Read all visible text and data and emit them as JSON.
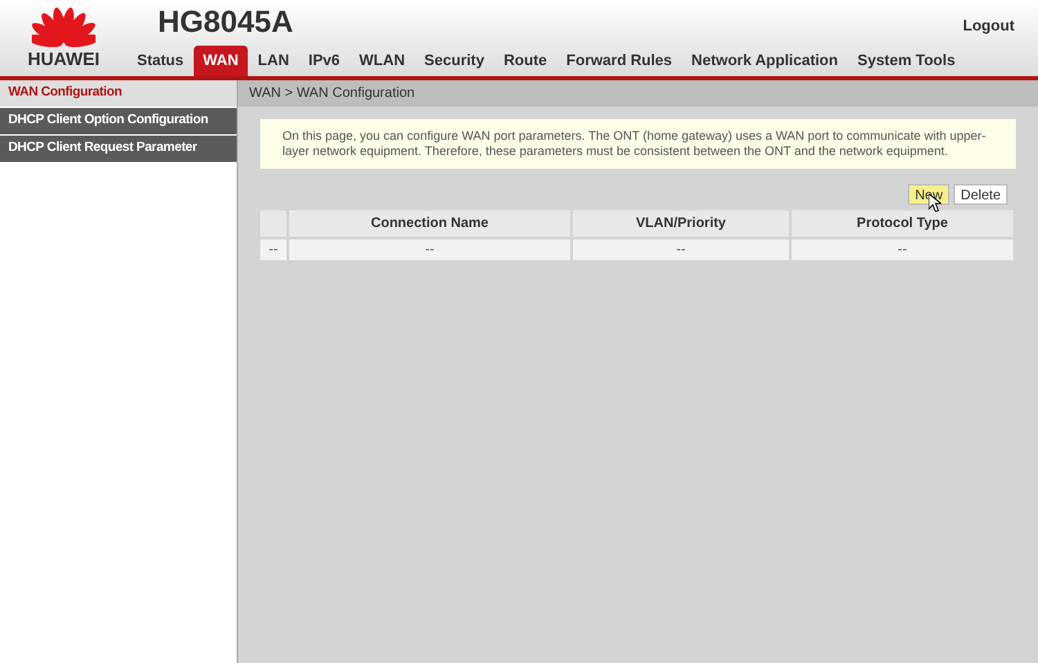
{
  "header": {
    "brand": "HUAWEI",
    "model": "HG8045A",
    "logout": "Logout"
  },
  "nav": [
    {
      "label": "Status",
      "selected": false
    },
    {
      "label": "WAN",
      "selected": true
    },
    {
      "label": "LAN",
      "selected": false
    },
    {
      "label": "IPv6",
      "selected": false
    },
    {
      "label": "WLAN",
      "selected": false
    },
    {
      "label": "Security",
      "selected": false
    },
    {
      "label": "Route",
      "selected": false
    },
    {
      "label": "Forward Rules",
      "selected": false
    },
    {
      "label": "Network Application",
      "selected": false
    },
    {
      "label": "System Tools",
      "selected": false
    }
  ],
  "sidebar": {
    "items": [
      {
        "label": "WAN Configuration",
        "selected": true
      },
      {
        "label": "DHCP Client Option Configuration",
        "selected": false
      },
      {
        "label": "DHCP Client Request Parameter",
        "selected": false
      }
    ]
  },
  "breadcrumb": "WAN > WAN Configuration",
  "notice": "On this page, you can configure WAN port parameters. The ONT (home gateway) uses a WAN port to communicate with upper-layer network equipment. Therefore, these parameters must be consistent between the ONT and the network equipment.",
  "buttons": [
    "New",
    "Delete"
  ],
  "table": {
    "columns": [
      "",
      "Connection Name",
      "VLAN/Priority",
      "Protocol Type"
    ],
    "rows": [
      [
        "--",
        "--",
        "--",
        "--"
      ]
    ]
  }
}
